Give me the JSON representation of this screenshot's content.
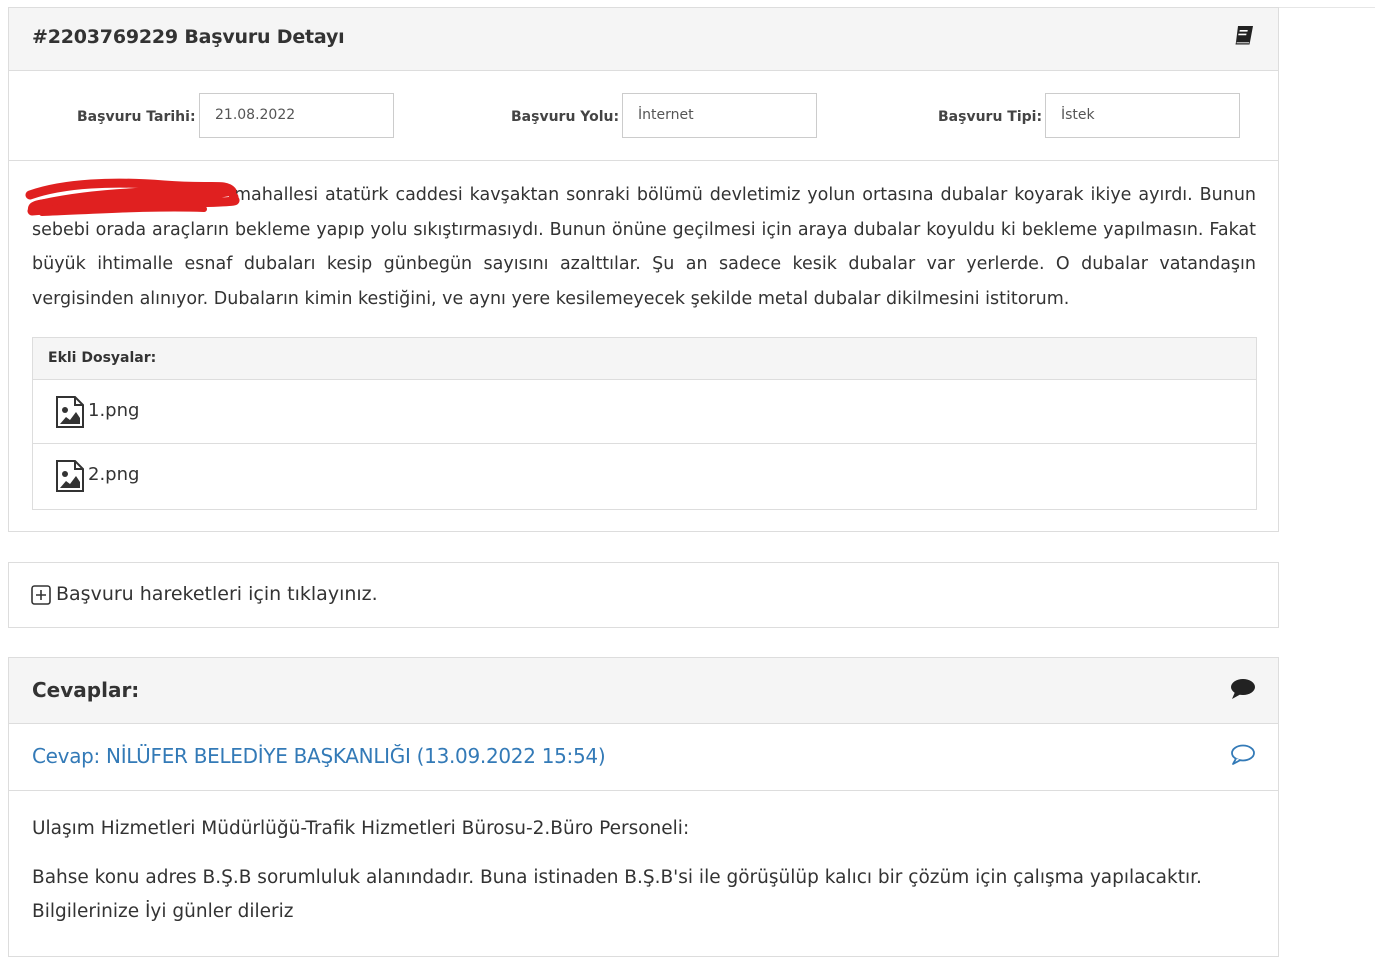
{
  "detail": {
    "title": "#2203769229 Başvuru Detayı",
    "icon": "book-icon",
    "fields": [
      {
        "label": "Başvuru Tarihi:",
        "value": "21.08.2022"
      },
      {
        "label": "Başvuru Yolu:",
        "value": "İnternet"
      },
      {
        "label": "Başvuru Tipi:",
        "value": "İstek"
      }
    ],
    "body": "mahallesi atatürk caddesi kavşaktan sonraki bölümü devletimiz yolun ortasına dubalar koyarak ikiye ayırdı. Bunun sebebi orada araçların bekleme yapıp yolu sıkıştırmasıydı. Bunun önüne geçilmesi için araya dubalar koyuldu ki bekleme yapılmasın. Fakat büyük ihtimalle esnaf dubaları kesip günbegün sayısını azalttılar. Şu an sadece kesik dubalar var yerlerde. O dubalar vatandaşın vergisinden alınıyor. Dubaların kimin kestiğini, ve aynı yere kesilemeyecek şekilde metal dubalar dikilmesini istitorum.",
    "files": {
      "heading": "Ekli Dosyalar:",
      "items": [
        "1.png",
        "2.png"
      ]
    }
  },
  "moves": {
    "label": "Başvuru hareketleri için tıklayınız."
  },
  "answers": {
    "title": "Cevaplar:",
    "answer": {
      "title": "Cevap: NİLÜFER BELEDİYE BAŞKANLIĞI (13.09.2022 15:54)",
      "lines": [
        "Ulaşım Hizmetleri Müdürlüğü-Trafik Hizmetleri Bürosu-2.Büro Personeli:",
        "Bahse konu adres B.Ş.B sorumluluk alanındadır. Buna istinaden B.Ş.B'si ile görüşülüp kalıcı bir çözüm için çalışma yapılacaktır.",
        "Bilgilerinize İyi günler dileriz"
      ]
    }
  },
  "colors": {
    "link": "#337ab7",
    "panel_heading_bg": "#f5f5f5",
    "border": "#dddddd",
    "redaction": "#e02020"
  }
}
